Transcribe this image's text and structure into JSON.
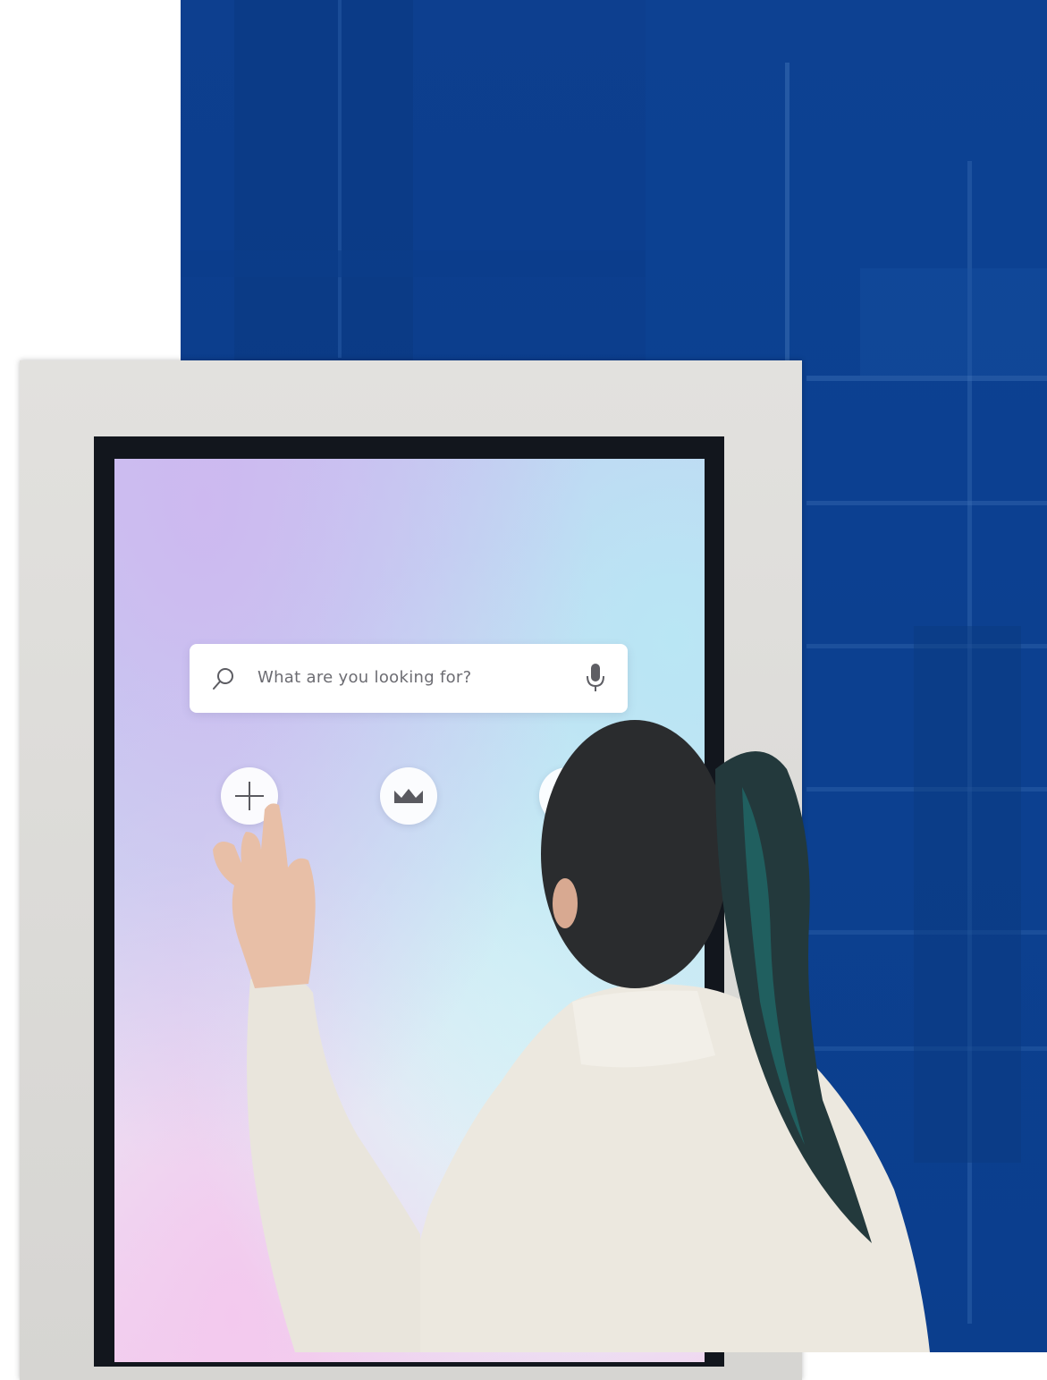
{
  "kiosk": {
    "search": {
      "placeholder": "What are you looking for?",
      "search_icon": "search-icon",
      "mic_icon": "microphone-icon"
    },
    "buttons": [
      {
        "icon": "plus-icon"
      },
      {
        "icon": "crown-icon"
      },
      {
        "icon": "partially-hidden-icon"
      }
    ]
  },
  "colors": {
    "backdrop_blue": "#0b3d8c",
    "frame": "#dcdbd8",
    "bezel": "#12161d",
    "sweater": "#ece8df",
    "hair": "#2a2c2e",
    "hair_teal": "#1f6f6d"
  }
}
